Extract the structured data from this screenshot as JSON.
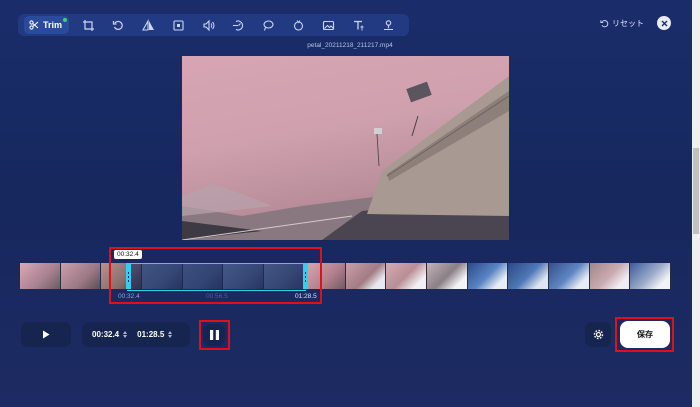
{
  "toolbar": {
    "trim_label": "Trim",
    "tools": [
      "trim-icon",
      "crop-icon",
      "rotate-icon",
      "flip-icon",
      "aspect-icon",
      "volume-icon",
      "speed-icon",
      "loop-icon",
      "filter-icon",
      "image-icon",
      "text-icon",
      "watermark-icon"
    ]
  },
  "header": {
    "reset_label": "リセット"
  },
  "video": {
    "filename": "petal_20211218_211217.mp4"
  },
  "timeline": {
    "bubble": "00:32.4",
    "start_label": "00:32.4",
    "mid_label": "00:56.5",
    "end_label": "01:28.5"
  },
  "controls": {
    "start_time": "00:32.4",
    "end_time": "01:28.5",
    "save_label": "保存"
  },
  "colors": {
    "accent": "#2fd0f0",
    "highlight": "#e0101a",
    "background": "#1a2d6b"
  }
}
